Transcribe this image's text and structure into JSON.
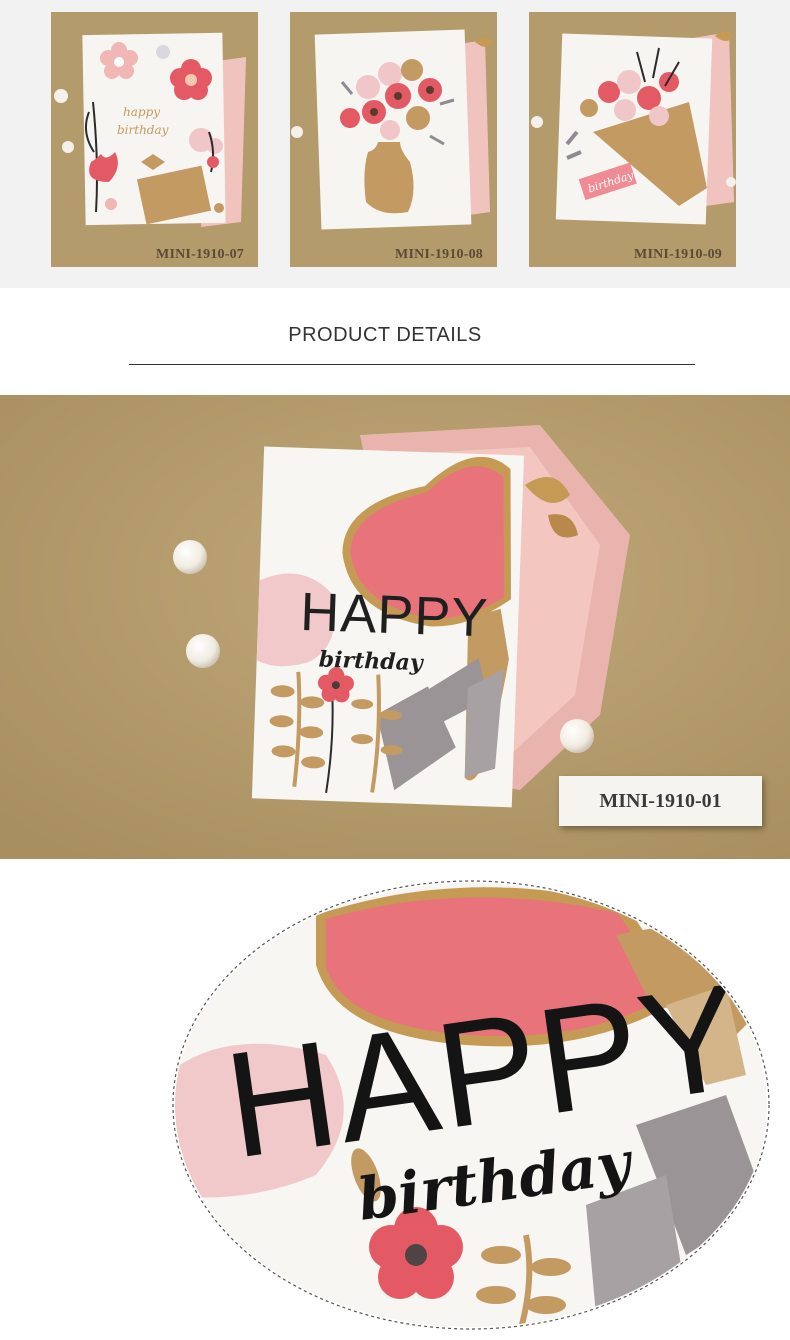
{
  "variants": [
    {
      "code": "MINI-1910-07",
      "card_text": [
        "happy",
        "birthday"
      ]
    },
    {
      "code": "MINI-1910-08"
    },
    {
      "code": "MINI-1910-09",
      "card_tag": "birthday"
    }
  ],
  "section": {
    "title": "PRODUCT DETAILS"
  },
  "main": {
    "code": "MINI-1910-01",
    "card_text": {
      "line1": "HAPPY",
      "line2": "birthday"
    }
  },
  "closeup": {
    "line1": "HAPPY",
    "line2": "birthday"
  },
  "colors": {
    "kraft": "#b39b6c",
    "pink": "#e8707a",
    "gold": "#c39a62",
    "grey": "#9b9496",
    "blush": "#f0c6c8"
  }
}
